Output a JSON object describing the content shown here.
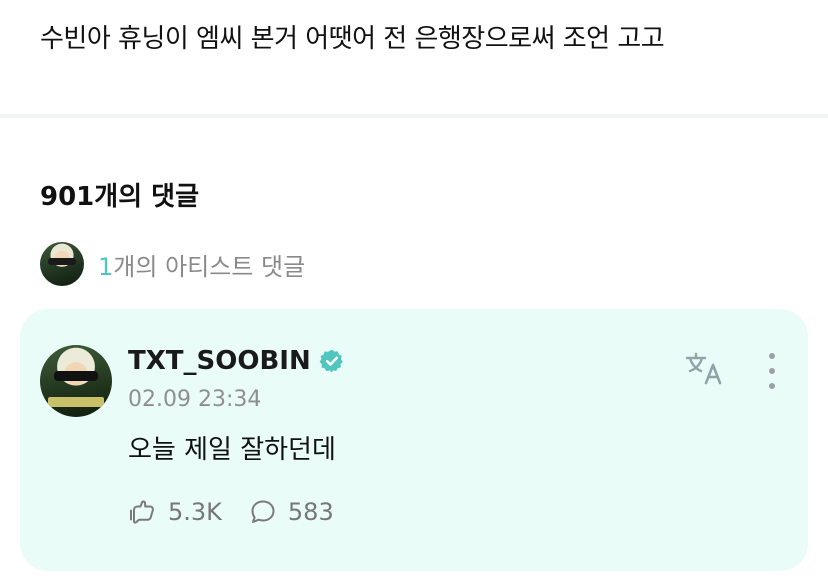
{
  "post": {
    "text": "수빈아 휴닝이 엠씨 본거 어땟어 전 은행장으로써 조언 고고"
  },
  "comments": {
    "header": "901개의 댓글",
    "artist_summary": {
      "count": "1",
      "label": "개의 아티스트 댓글"
    }
  },
  "comment": {
    "username": "TXT_SOOBIN",
    "timestamp": "02.09 23:34",
    "text": "오늘 제일 잘하던데",
    "likes": "5.3K",
    "replies": "583"
  },
  "icons": {
    "verified": "verified-badge-icon",
    "translate": "translate-icon",
    "more": "more-vertical-icon",
    "like": "like-hand-icon",
    "reply": "reply-bubble-icon"
  },
  "colors": {
    "accent": "#4fc6c0",
    "card_bg": "#eafcf8",
    "muted": "#8f8f8f"
  }
}
